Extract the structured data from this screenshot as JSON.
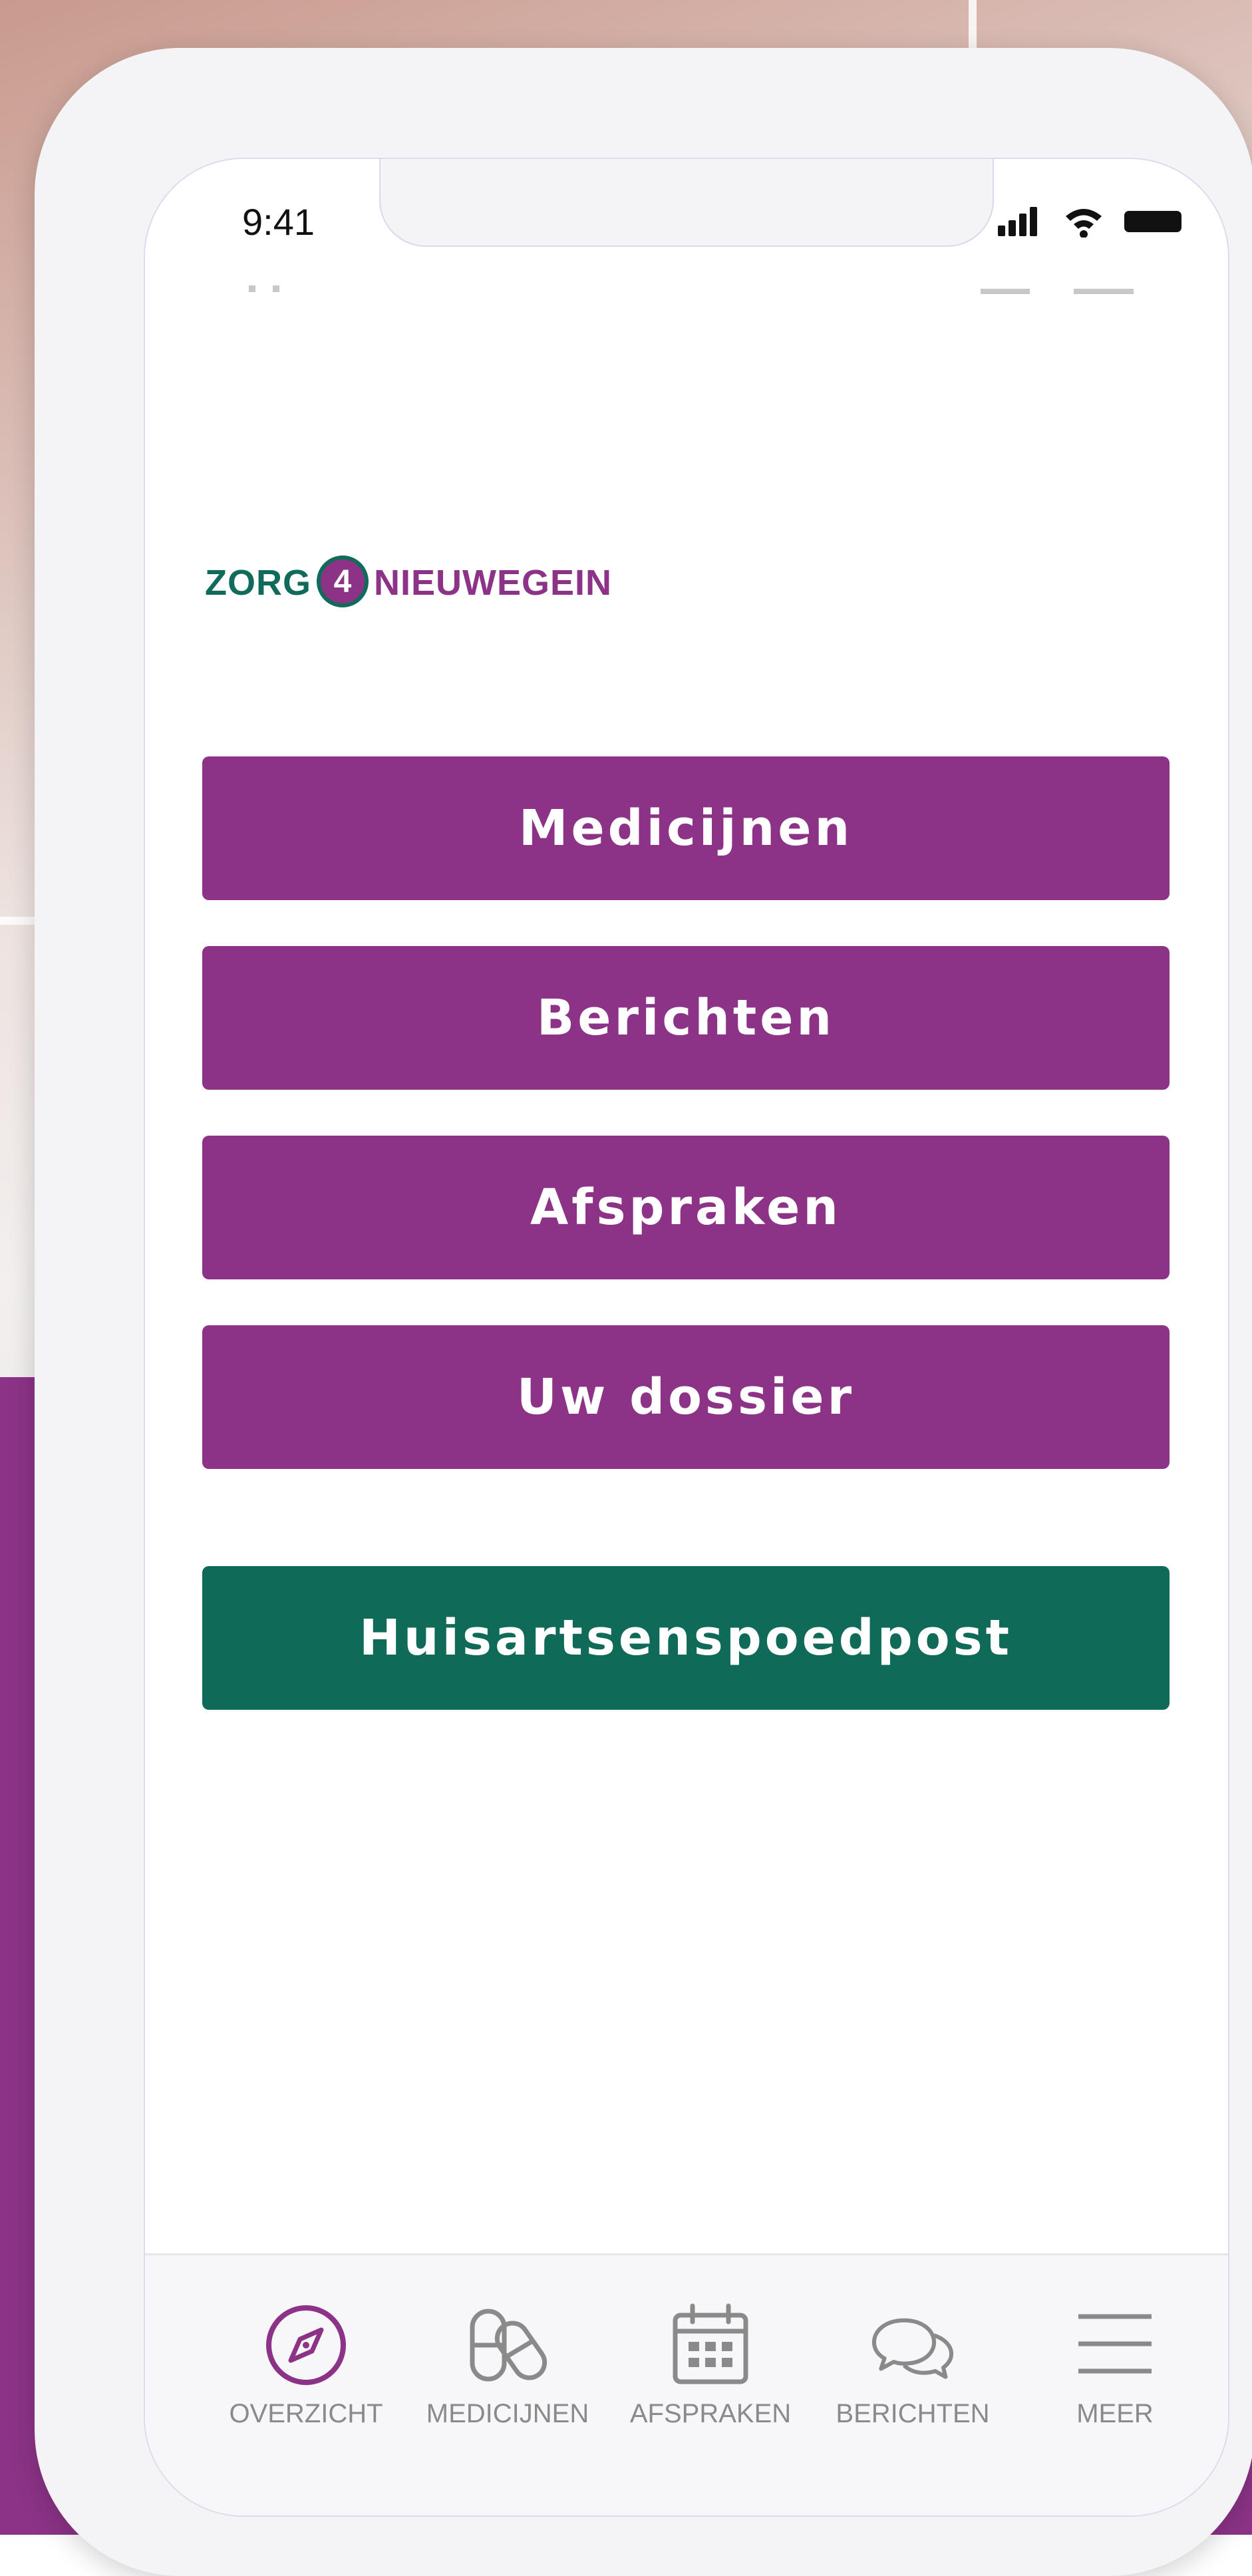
{
  "status_bar": {
    "time": "9:41"
  },
  "logo": {
    "part1": "ZORG",
    "number": "4",
    "part2": "NIEUWEGEIN"
  },
  "menu": {
    "buttons": [
      {
        "label": "Medicijnen"
      },
      {
        "label": "Berichten"
      },
      {
        "label": "Afspraken"
      },
      {
        "label": "Uw dossier"
      }
    ],
    "emergency": {
      "label": "Huisartsenspoedpost"
    }
  },
  "tabbar": {
    "tabs": [
      {
        "label": "OVERZICHT",
        "icon": "compass-icon",
        "active": true
      },
      {
        "label": "MEDICIJNEN",
        "icon": "pills-icon",
        "active": false
      },
      {
        "label": "AFSPRAKEN",
        "icon": "calendar-icon",
        "active": false
      },
      {
        "label": "BERICHTEN",
        "icon": "chat-bubbles-icon",
        "active": false
      },
      {
        "label": "MEER",
        "icon": "menu-icon",
        "active": false
      }
    ]
  },
  "colors": {
    "brand_purple": "#8c3387",
    "brand_green": "#0f6b58",
    "tab_inactive": "#8a8a8a"
  }
}
